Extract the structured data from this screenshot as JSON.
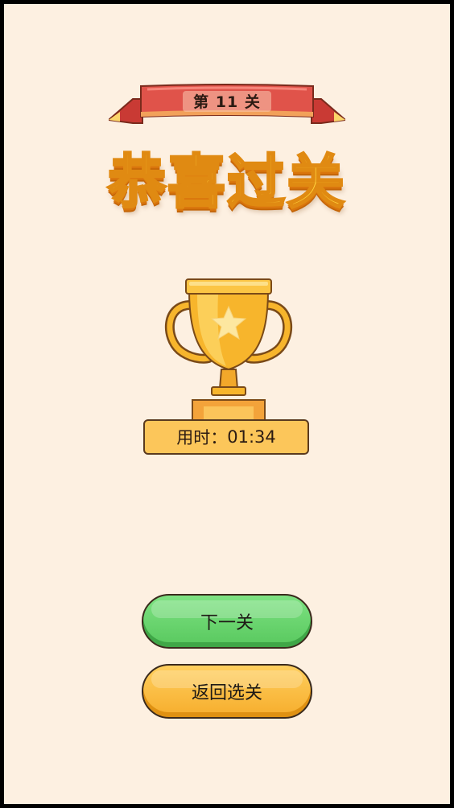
{
  "level": {
    "label": "第 11 关"
  },
  "title": "恭喜过关",
  "result": {
    "time_label": "用时：",
    "time_value": "01:34"
  },
  "buttons": {
    "next": "下一关",
    "back": "返回选关"
  },
  "colors": {
    "background": "#fdf0e1",
    "ribbon": "#e0534a",
    "title": "#ffd23c",
    "trophy": "#f7b52c",
    "next_button": "#6ed672",
    "back_button": "#fbbe44"
  },
  "icons": {
    "trophy": "trophy-icon",
    "star": "star-icon"
  }
}
